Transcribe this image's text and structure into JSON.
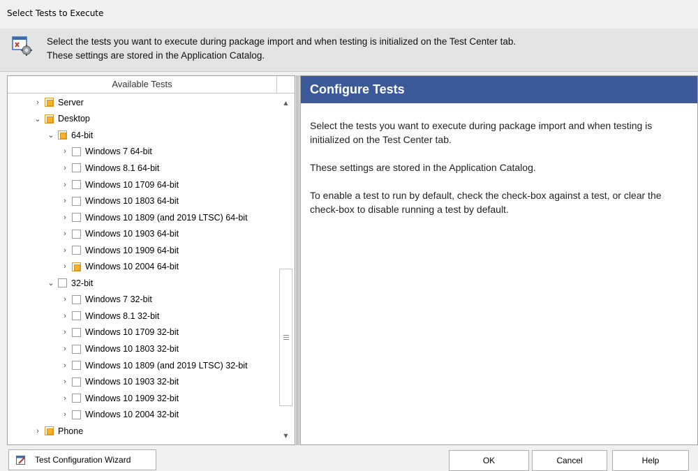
{
  "window": {
    "title": "Select Tests to Execute"
  },
  "info": {
    "line1": "Select the tests you want to execute during package import and when testing is initialized on the Test Center tab.",
    "line2": "These settings are stored in the Application Catalog."
  },
  "tree": {
    "header": "Available Tests",
    "items": [
      {
        "label": "Server",
        "chevron": "›",
        "state": "partial"
      },
      {
        "label": "Desktop",
        "chevron": "⌄",
        "state": "partial"
      },
      {
        "label": "64-bit",
        "chevron": "⌄",
        "state": "partial"
      },
      {
        "label": "Windows 7 64-bit",
        "chevron": "›",
        "state": "unchecked"
      },
      {
        "label": "Windows 8.1 64-bit",
        "chevron": "›",
        "state": "unchecked"
      },
      {
        "label": "Windows 10 1709 64-bit",
        "chevron": "›",
        "state": "unchecked"
      },
      {
        "label": "Windows 10 1803 64-bit",
        "chevron": "›",
        "state": "unchecked"
      },
      {
        "label": "Windows 10 1809 (and 2019 LTSC) 64-bit",
        "chevron": "›",
        "state": "unchecked"
      },
      {
        "label": "Windows 10 1903 64-bit",
        "chevron": "›",
        "state": "unchecked"
      },
      {
        "label": "Windows 10 1909 64-bit",
        "chevron": "›",
        "state": "unchecked"
      },
      {
        "label": "Windows 10 2004 64-bit",
        "chevron": "›",
        "state": "partial"
      },
      {
        "label": "32-bit",
        "chevron": "⌄",
        "state": "unchecked"
      },
      {
        "label": "Windows 7 32-bit",
        "chevron": "›",
        "state": "unchecked"
      },
      {
        "label": "Windows 8.1 32-bit",
        "chevron": "›",
        "state": "unchecked"
      },
      {
        "label": "Windows 10 1709 32-bit",
        "chevron": "›",
        "state": "unchecked"
      },
      {
        "label": "Windows 10 1803 32-bit",
        "chevron": "›",
        "state": "unchecked"
      },
      {
        "label": "Windows 10 1809 (and 2019 LTSC) 32-bit",
        "chevron": "›",
        "state": "unchecked"
      },
      {
        "label": "Windows 10 1903 32-bit",
        "chevron": "›",
        "state": "unchecked"
      },
      {
        "label": "Windows 10 1909 32-bit",
        "chevron": "›",
        "state": "unchecked"
      },
      {
        "label": "Windows 10 2004 32-bit",
        "chevron": "›",
        "state": "unchecked"
      },
      {
        "label": "Phone",
        "chevron": "›",
        "state": "partial"
      }
    ]
  },
  "config": {
    "title": "Configure Tests",
    "p1": "Select the tests you want to execute during package import and when testing is initialized on the Test Center tab.",
    "p2": "These settings are stored in the Application Catalog.",
    "p3": "To enable a test to run by default, check the check-box against a test, or clear the check-box to disable running a test by default."
  },
  "buttons": {
    "wizard": "Test Configuration Wizard",
    "ok": "OK",
    "cancel": "Cancel",
    "help": "Help"
  },
  "colors": {
    "header_blue": "#3c5a9a",
    "partial_orange": "#f6b32a"
  }
}
